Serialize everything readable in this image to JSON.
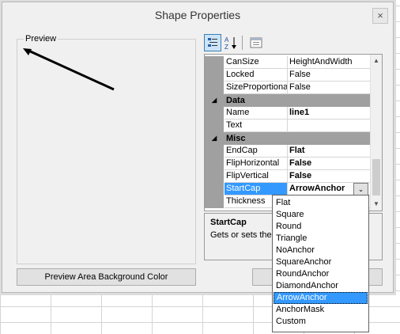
{
  "dialog": {
    "title": "Shape Properties",
    "close_glyph": "×"
  },
  "preview": {
    "label": "Preview",
    "background_button_label": "Preview Area Background Color"
  },
  "ok_button_label": "",
  "toolbar": {
    "categorized_icon": "categorized-icon",
    "alphabetical_icon": "alphabetical-icon",
    "property_pages_icon": "property-pages-icon"
  },
  "property_grid": {
    "rows": [
      {
        "kind": "prop",
        "name": "CanSize",
        "value": "HeightAndWidth",
        "bold": false
      },
      {
        "kind": "prop",
        "name": "Locked",
        "value": "False",
        "bold": false
      },
      {
        "kind": "prop",
        "name": "SizeProportional",
        "value": "False",
        "bold": false
      },
      {
        "kind": "cat",
        "name": "Data",
        "toggle": "◢"
      },
      {
        "kind": "prop",
        "name": "Name",
        "value": "line1",
        "bold": true
      },
      {
        "kind": "prop",
        "name": "Text",
        "value": "",
        "bold": false
      },
      {
        "kind": "cat",
        "name": "Misc",
        "toggle": "◢"
      },
      {
        "kind": "prop",
        "name": "EndCap",
        "value": "Flat",
        "bold": true
      },
      {
        "kind": "prop",
        "name": "FlipHorizontal",
        "value": "False",
        "bold": true
      },
      {
        "kind": "prop",
        "name": "FlipVertical",
        "value": "False",
        "bold": true
      },
      {
        "kind": "prop",
        "name": "StartCap",
        "value": "ArrowAnchor",
        "bold": true,
        "selected": true,
        "dropdown_glyph": "⌄"
      },
      {
        "kind": "prop",
        "name": "Thickness",
        "value": "",
        "bold": false
      }
    ],
    "scroll_up_glyph": "▲",
    "scroll_down_glyph": "▼"
  },
  "help": {
    "title": "StartCap",
    "text": "Gets or sets the s"
  },
  "dropdown": {
    "options": [
      "Flat",
      "Square",
      "Round",
      "Triangle",
      "NoAnchor",
      "SquareAnchor",
      "RoundAnchor",
      "DiamondAnchor",
      "ArrowAnchor",
      "AnchorMask",
      "Custom"
    ],
    "selected": "ArrowAnchor"
  },
  "colors": {
    "selection": "#3399ff",
    "category_band": "#a0a0a0",
    "dialog_bg": "#f0f0f0"
  }
}
